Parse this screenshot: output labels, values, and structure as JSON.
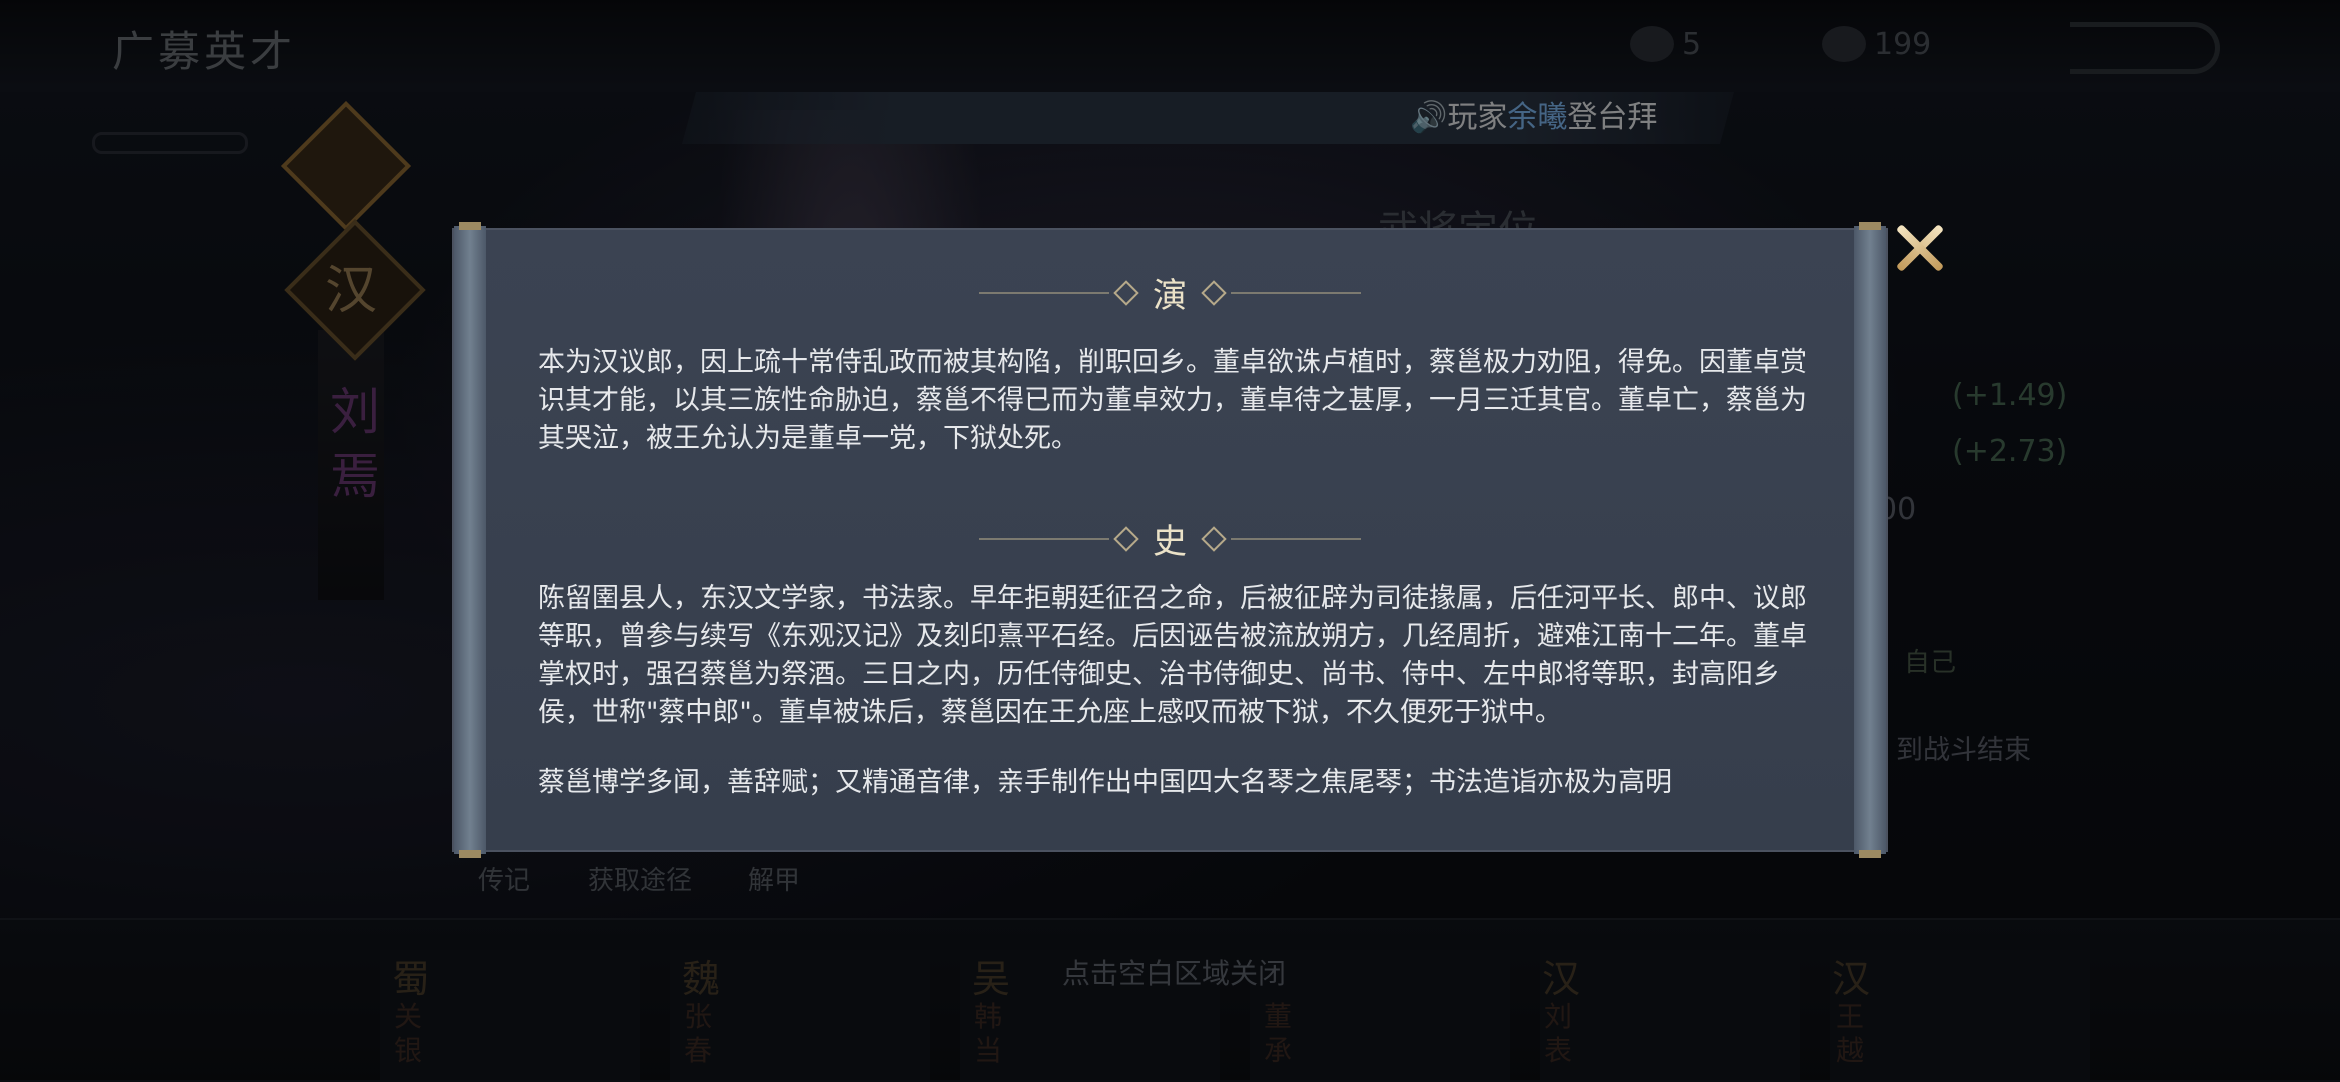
{
  "header": {
    "title": "广募英才",
    "resource1_value": "5",
    "resource2_value": "199"
  },
  "broadcast": {
    "prefix": "玩家",
    "player": "余曦",
    "suffix": "登台拜"
  },
  "hero": {
    "faction": "汉",
    "name": "刘焉"
  },
  "background_panel": {
    "title": "武将定位",
    "stat1_bonus": "(+1.49)",
    "stat2_bonus": "(+2.73)",
    "stat3_value": "00",
    "skill_tag": "自己",
    "skill_text": "到战斗结束"
  },
  "tabs": [
    "传记",
    "获取途径",
    "解甲"
  ],
  "dismiss_hint": "点击空白区域关闭",
  "bottom_cards": [
    {
      "faction": "蜀",
      "name": "关银"
    },
    {
      "faction": "魏",
      "name": "张春"
    },
    {
      "faction": "吴",
      "name": "韩当"
    },
    {
      "faction": "",
      "name": "董承"
    },
    {
      "faction": "汉",
      "name": "刘表"
    },
    {
      "faction": "汉",
      "name": "王越"
    }
  ],
  "dialog": {
    "section1_title": "演",
    "section1_text": "本为汉议郎，因上疏十常侍乱政而被其构陷，削职回乡。董卓欲诛卢植时，蔡邕极力劝阻，得免。因董卓赏识其才能，以其三族性命胁迫，蔡邕不得已而为董卓效力，董卓待之甚厚，一月三迁其官。董卓亡，蔡邕为其哭泣，被王允认为是董卓一党，下狱处死。",
    "section2_title": "史",
    "section2_text": "陈留圉县人，东汉文学家，书法家。早年拒朝廷征召之命，后被征辟为司徒掾属，后任河平长、郎中、议郎等职，曾参与续写《东观汉记》及刻印熹平石经。后因诬告被流放朔方，几经周折，避难江南十二年。董卓掌权时，强召蔡邕为祭酒。三日之内，历任侍御史、治书侍御史、尚书、侍中、左中郎将等职，封高阳乡侯，世称\"蔡中郎\"。董卓被诛后，蔡邕因在王允座上感叹而被下狱，不久便死于狱中。",
    "section2_text2": "蔡邕博学多闻，善辞赋；又精通音律，亲手制作出中国四大名琴之焦尾琴；书法造诣亦极为高明"
  }
}
